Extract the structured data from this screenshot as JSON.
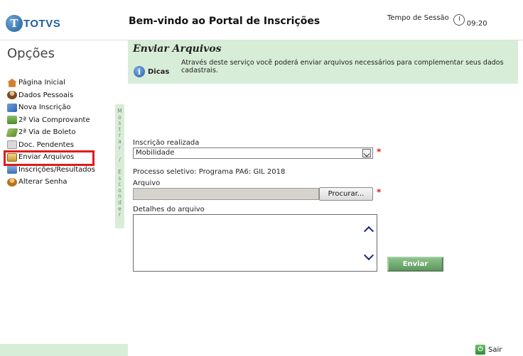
{
  "header": {
    "logo_letter": "T",
    "logo_text": "TOTVS",
    "title": "Bem-vindo ao Portal de Inscrições",
    "session_label": "Tempo de Sessão",
    "session_time": "09:20"
  },
  "sidebar": {
    "title": "Opções",
    "items": [
      {
        "label": "Página Inicial",
        "icon": "home-icon"
      },
      {
        "label": "Dados Pessoais",
        "icon": "person-icon"
      },
      {
        "label": "Nova Inscrição",
        "icon": "edit-icon"
      },
      {
        "label": "2ª Via Comprovante",
        "icon": "printer-icon"
      },
      {
        "label": "2ª Via de Boleto",
        "icon": "boleto-icon"
      },
      {
        "label": "Doc. Pendentes",
        "icon": "document-icon"
      },
      {
        "label": "Enviar Arquivos",
        "icon": "upload-icon"
      },
      {
        "label": "Inscrições/Resultados",
        "icon": "results-icon"
      },
      {
        "label": "Alterar Senha",
        "icon": "key-icon"
      }
    ],
    "toggle_text": "Mostrar / Esconder"
  },
  "panel": {
    "title": "Enviar Arquivos",
    "tips_label": "Dicas",
    "tips_text": "Através deste serviço você poderá enviar arquivos necessários para complementar seus dados cadastrais."
  },
  "form": {
    "inscription_label": "Inscrição realizada",
    "inscription_value": "Mobilidade",
    "process_text": "Processo seletivo: Programa PA6: GIL 2018",
    "file_label": "Arquivo",
    "browse_label": "Procurar...",
    "details_label": "Detalhes do arquivo",
    "details_value": "",
    "send_label": "Enviar",
    "required_mark": "*"
  },
  "footer": {
    "logout_label": "Sair",
    "logout_icon_glyph": "⏻"
  },
  "colors": {
    "panel_bg": "#d8edd8",
    "highlight_border": "#e01b1b",
    "send_button": "#6fae6f",
    "brand_blue": "#1f5e9c"
  }
}
